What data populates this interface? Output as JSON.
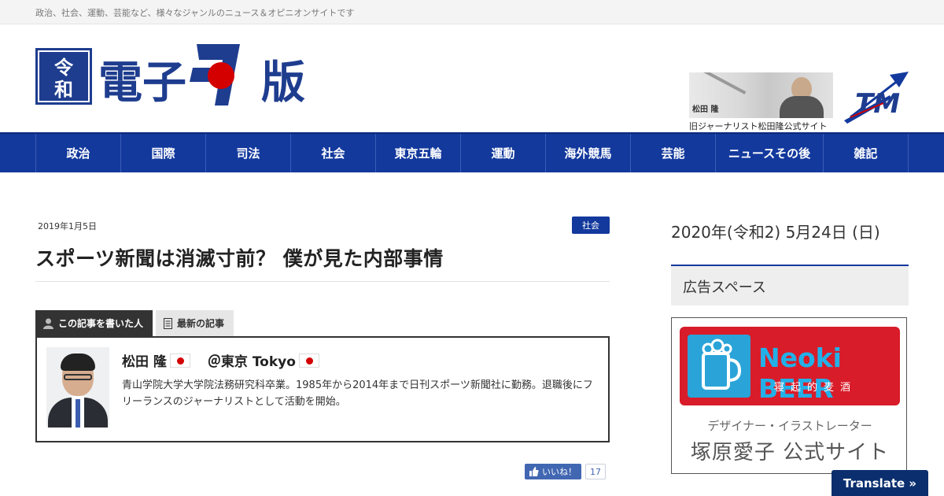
{
  "topbar": {
    "tagline": "政治、社会、運動、芸能など、様々なジャンルのニュース＆オピニオンサイトです"
  },
  "header": {
    "logo_reiwa": "令和",
    "logo_text_1": "電子",
    "logo_text_2": "版",
    "banner_name": "松田 隆",
    "banner_caption": "旧ジャーナリスト松田隆公式サイト",
    "tm_logo": "TM"
  },
  "nav": {
    "items": [
      {
        "label": "政治"
      },
      {
        "label": "国際"
      },
      {
        "label": "司法"
      },
      {
        "label": "社会"
      },
      {
        "label": "東京五輪"
      },
      {
        "label": "運動"
      },
      {
        "label": "海外競馬"
      },
      {
        "label": "芸能"
      },
      {
        "label": "ニュースその後"
      },
      {
        "label": "雑記"
      }
    ]
  },
  "article": {
    "date": "2019年1月5日",
    "category": "社会",
    "title": "スポーツ新聞は消滅寸前？ 僕が見た内部事情"
  },
  "author_box": {
    "tab_author": "この記事を書いた人",
    "tab_latest": "最新の記事",
    "name": "松田 隆",
    "location": "＠東京 Tokyo",
    "bio": "青山学院大学大学院法務研究科卒業。1985年から2014年まで日刊スポーツ新聞社に勤務。退職後にフリーランスのジャーナリストとして活動を開始。"
  },
  "like": {
    "label": "いいね！",
    "count": "17"
  },
  "sidebar": {
    "date": "2020年(令和2) 5月24日 (日)",
    "ad_heading": "広告スペース",
    "ad_title": "Neoki BEER",
    "ad_subtitle": "寝起的麦酒",
    "ad_line1": "デザイナー・イラストレーター",
    "ad_line2": "塚原愛子 公式サイト"
  },
  "translate": {
    "label": "Translate »"
  },
  "colors": {
    "nav_blue": "#13399d",
    "accent_red": "#d40000",
    "translate_bg": "#0b2f6e"
  }
}
